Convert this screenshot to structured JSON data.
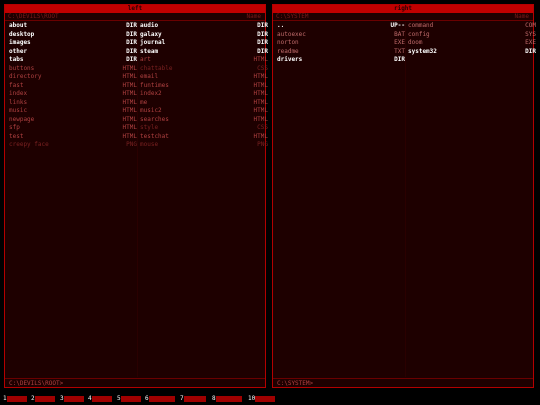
{
  "left_panel": {
    "title": "left",
    "path_header": "C:\\DEVILS\\ROOT",
    "sort_label": "Name",
    "col1": [
      {
        "name": "about",
        "type": "DIR",
        "kind": "dir"
      },
      {
        "name": "desktop",
        "type": "DIR",
        "kind": "dir"
      },
      {
        "name": "images",
        "type": "DIR",
        "kind": "dir"
      },
      {
        "name": "other",
        "type": "DIR",
        "kind": "dir"
      },
      {
        "name": "tabs",
        "type": "DIR",
        "kind": "dir"
      },
      {
        "name": "buttons",
        "type": "HTML",
        "kind": "file"
      },
      {
        "name": "directory",
        "type": "HTML",
        "kind": "file"
      },
      {
        "name": "fast",
        "type": "HTML",
        "kind": "file"
      },
      {
        "name": "index",
        "type": "HTML",
        "kind": "file"
      },
      {
        "name": "links",
        "type": "HTML",
        "kind": "file"
      },
      {
        "name": "music",
        "type": "HTML",
        "kind": "file"
      },
      {
        "name": "newpage",
        "type": "HTML",
        "kind": "file"
      },
      {
        "name": "sfp",
        "type": "HTML",
        "kind": "file"
      },
      {
        "name": "test",
        "type": "HTML",
        "kind": "file"
      },
      {
        "name": "creepy face",
        "type": "PNG",
        "kind": "dim"
      }
    ],
    "col2": [
      {
        "name": "audio",
        "type": "DIR",
        "kind": "dir"
      },
      {
        "name": "galaxy",
        "type": "DIR",
        "kind": "dir"
      },
      {
        "name": "journal",
        "type": "DIR",
        "kind": "dir"
      },
      {
        "name": "steam",
        "type": "DIR",
        "kind": "dir"
      },
      {
        "name": "art",
        "type": "HTML",
        "kind": "file"
      },
      {
        "name": "chattable",
        "type": "CSS",
        "kind": "dim"
      },
      {
        "name": "email",
        "type": "HTML",
        "kind": "file"
      },
      {
        "name": "funtimes",
        "type": "HTML",
        "kind": "file"
      },
      {
        "name": "index2",
        "type": "HTML",
        "kind": "file"
      },
      {
        "name": "me",
        "type": "HTML",
        "kind": "file"
      },
      {
        "name": "music2",
        "type": "HTML",
        "kind": "file"
      },
      {
        "name": "searches",
        "type": "HTML",
        "kind": "file"
      },
      {
        "name": "style",
        "type": "CSS",
        "kind": "dim"
      },
      {
        "name": "testchat",
        "type": "HTML",
        "kind": "file"
      },
      {
        "name": "mouse",
        "type": "PNG",
        "kind": "dim"
      }
    ],
    "footer_path": "C:\\DEVILS\\ROOT>"
  },
  "right_panel": {
    "title": "right",
    "path_header": "C:\\SYSTEM",
    "sort_label": "Name",
    "col1": [
      {
        "name": "..",
        "type": "UP--",
        "kind": "dir"
      },
      {
        "name": "autoexec",
        "type": "BAT",
        "kind": "exe"
      },
      {
        "name": "norton",
        "type": "EXE",
        "kind": "exe"
      },
      {
        "name": "readme",
        "type": "TXT",
        "kind": "exe"
      },
      {
        "name": "drivers",
        "type": "DIR",
        "kind": "dir"
      }
    ],
    "col2": [
      {
        "name": "command",
        "type": "COM",
        "kind": "exe"
      },
      {
        "name": "config",
        "type": "SYS",
        "kind": "exe"
      },
      {
        "name": "doom",
        "type": "EXE",
        "kind": "exe"
      },
      {
        "name": "system32",
        "type": "DIR",
        "kind": "dir"
      }
    ],
    "footer_path": "C:\\SYSTEM>"
  },
  "function_keys": [
    {
      "num": "1"
    },
    {
      "num": "2"
    },
    {
      "num": "3"
    },
    {
      "num": "4"
    },
    {
      "num": "5"
    },
    {
      "num": "6"
    },
    {
      "num": "7"
    },
    {
      "num": "8"
    },
    {
      "num": "10"
    }
  ],
  "colors": {
    "panel_bg": "#1e0000",
    "title_bar": "#c00000",
    "border": "#b30000",
    "dir_text": "#ffffff",
    "file_text": "#b04040"
  }
}
